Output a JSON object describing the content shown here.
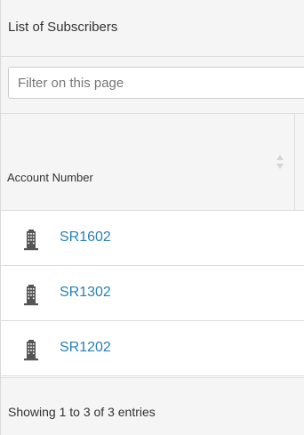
{
  "panel": {
    "title": "List of Subscribers"
  },
  "filter": {
    "placeholder": "Filter on this page",
    "value": ""
  },
  "table": {
    "columns": [
      {
        "label": "Account Number",
        "sort_icon": "sort-both-icon"
      }
    ],
    "rows": [
      {
        "account": "SR1602",
        "icon": "building-icon"
      },
      {
        "account": "SR1302",
        "icon": "building-icon"
      },
      {
        "account": "SR1202",
        "icon": "building-icon"
      }
    ]
  },
  "footer": {
    "info": "Showing 1 to 3 of 3 entries"
  },
  "colors": {
    "link": "#2a7fb3",
    "header_bg": "#f5f5f5",
    "border": "#dddddd",
    "icon": "#555555"
  }
}
